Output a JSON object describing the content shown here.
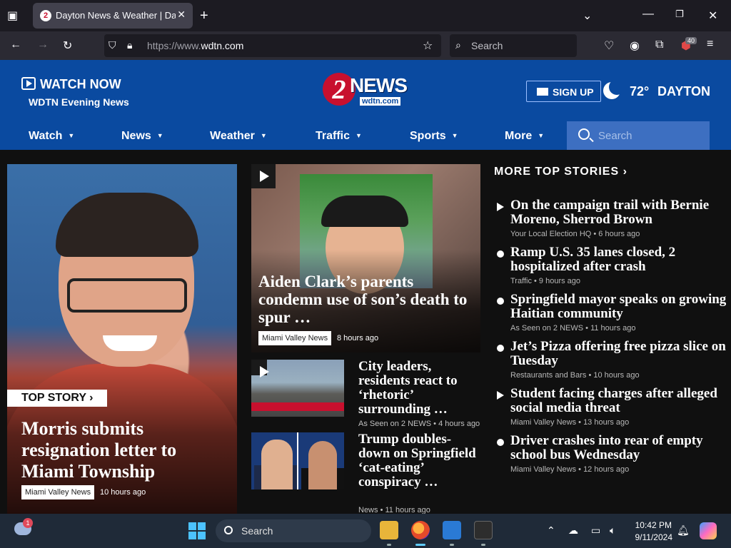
{
  "browser": {
    "tab_title": "Dayton News & Weather | Dayton",
    "tab_favicon": "2",
    "url_prefix": "https://www.",
    "url_domain": "wdtn.com",
    "search_placeholder": "Search",
    "extension_badge": "40"
  },
  "header": {
    "watch_now": "WATCH NOW",
    "evening_news": "WDTN Evening News",
    "logo_number": "2",
    "logo_text": "NEWS",
    "logo_domain": "wdtn.com",
    "signup": "SIGN UP",
    "temperature": "72°",
    "city": "DAYTON",
    "nav": [
      {
        "label": "Watch"
      },
      {
        "label": "News"
      },
      {
        "label": "Weather"
      },
      {
        "label": "Traffic"
      },
      {
        "label": "Sports"
      },
      {
        "label": "More"
      }
    ],
    "search_placeholder": "Search"
  },
  "top_story": {
    "label": "TOP STORY",
    "headline": "Morris submits resignation letter to Miami Township",
    "source": "Miami Valley News",
    "time": "10 hours ago"
  },
  "feature": {
    "headline": "Aiden Clark’s parents condemn use of son’s death to spur …",
    "source": "Miami Valley News",
    "time": "8 hours ago"
  },
  "secondary": [
    {
      "headline": "City leaders, residents react to ‘rhetoric’ surrounding …",
      "source": "As Seen on 2 NEWS",
      "time": "4 hours ago"
    },
    {
      "headline": "Trump doubles-down on Springfield ‘cat-eating’ conspiracy …",
      "source": "News",
      "time": "11 hours ago"
    }
  ],
  "more_stories": {
    "title": "MORE TOP STORIES",
    "items": [
      {
        "headline": "On the campaign trail with Bernie Moreno, Sherrod Brown",
        "source": "Your Local Election HQ",
        "time": "6 hours ago",
        "bullet": "play"
      },
      {
        "headline": "Ramp U.S. 35 lanes closed, 2 hospitalized after crash",
        "source": "Traffic",
        "time": "9 hours ago",
        "bullet": "dot"
      },
      {
        "headline": "Springfield mayor speaks on growing Haitian community",
        "source": "As Seen on 2 NEWS",
        "time": "11 hours ago",
        "bullet": "dot"
      },
      {
        "headline": "Jet’s Pizza offering free pizza slice on Tuesday",
        "source": "Restaurants and Bars",
        "time": "10 hours ago",
        "bullet": "dot"
      },
      {
        "headline": "Student facing charges after alleged social media threat",
        "source": "Miami Valley News",
        "time": "13 hours ago",
        "bullet": "play"
      },
      {
        "headline": "Driver crashes into rear of empty school bus Wednesday",
        "source": "Miami Valley News",
        "time": "12 hours ago",
        "bullet": "dot"
      }
    ]
  },
  "taskbar": {
    "weather_badge": "1",
    "search_placeholder": "Search",
    "time": "10:42 PM",
    "date": "9/11/2024"
  },
  "colors": {
    "header_blue": "#0a4aa0",
    "brand_red": "#c8102e",
    "content_bg": "#101010"
  }
}
